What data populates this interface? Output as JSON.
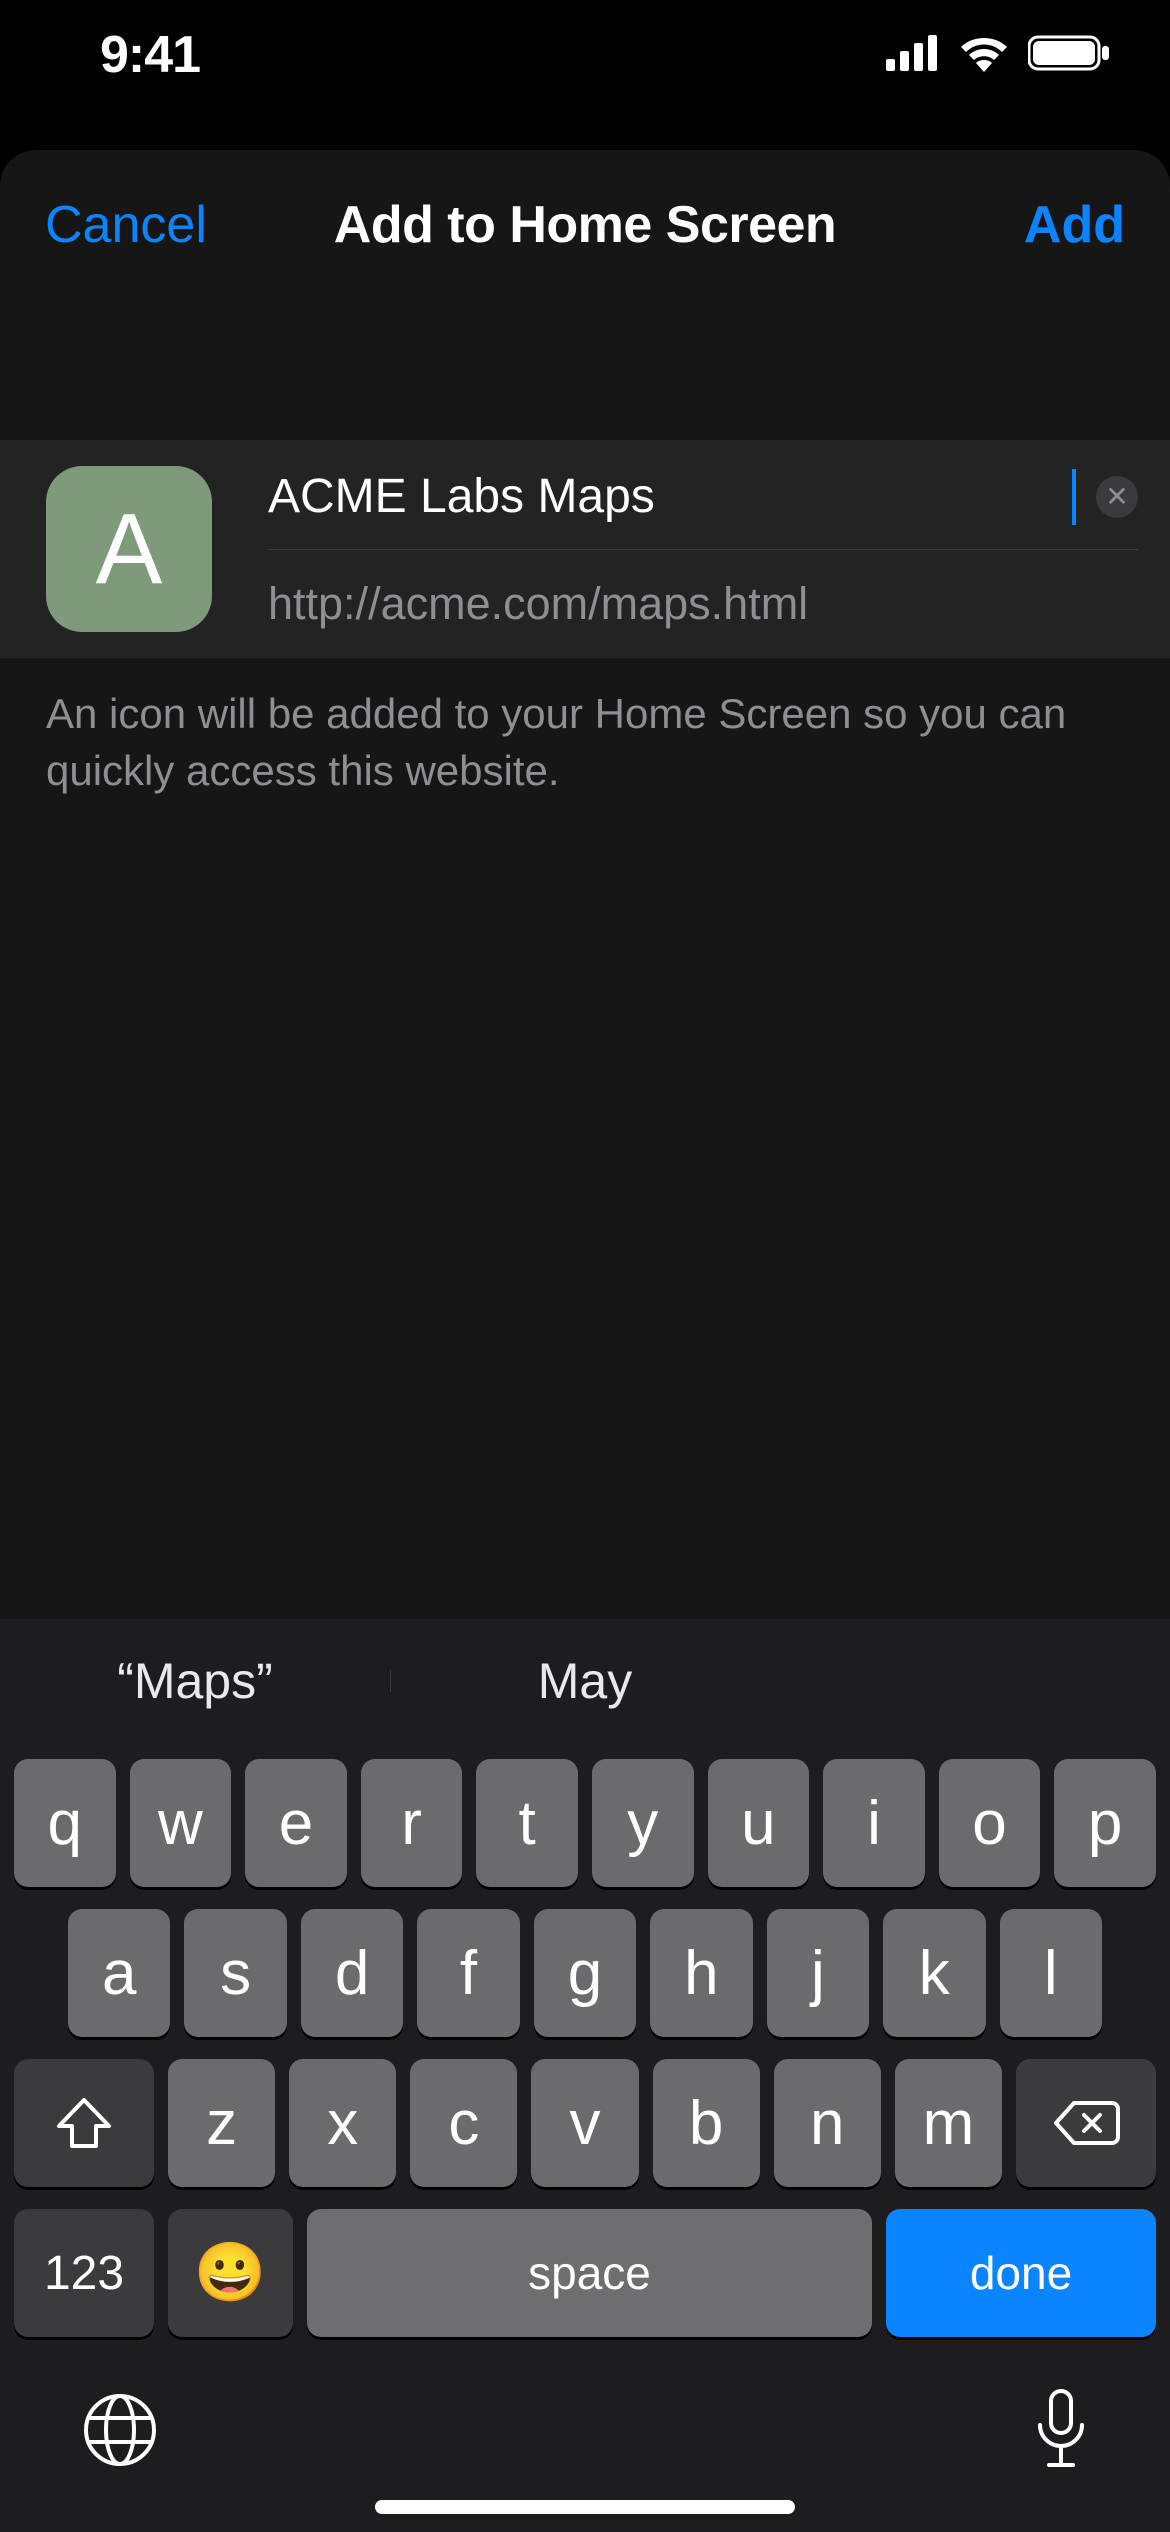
{
  "statusbar": {
    "time": "9:41"
  },
  "header": {
    "cancel": "Cancel",
    "title": "Add to Home Screen",
    "add": "Add"
  },
  "form": {
    "icon_letter": "A",
    "title_value": "ACME Labs Maps",
    "url": "http://acme.com/maps.html"
  },
  "footer_note": "An icon will be added to your Home Screen so you can quickly access this website.",
  "suggestions": [
    "“Maps”",
    "May",
    ""
  ],
  "keys": {
    "row1": [
      "q",
      "w",
      "e",
      "r",
      "t",
      "y",
      "u",
      "i",
      "o",
      "p"
    ],
    "row2": [
      "a",
      "s",
      "d",
      "f",
      "g",
      "h",
      "j",
      "k",
      "l"
    ],
    "row3": [
      "z",
      "x",
      "c",
      "v",
      "b",
      "n",
      "m"
    ],
    "numbers": "123",
    "space": "space",
    "done": "done"
  }
}
